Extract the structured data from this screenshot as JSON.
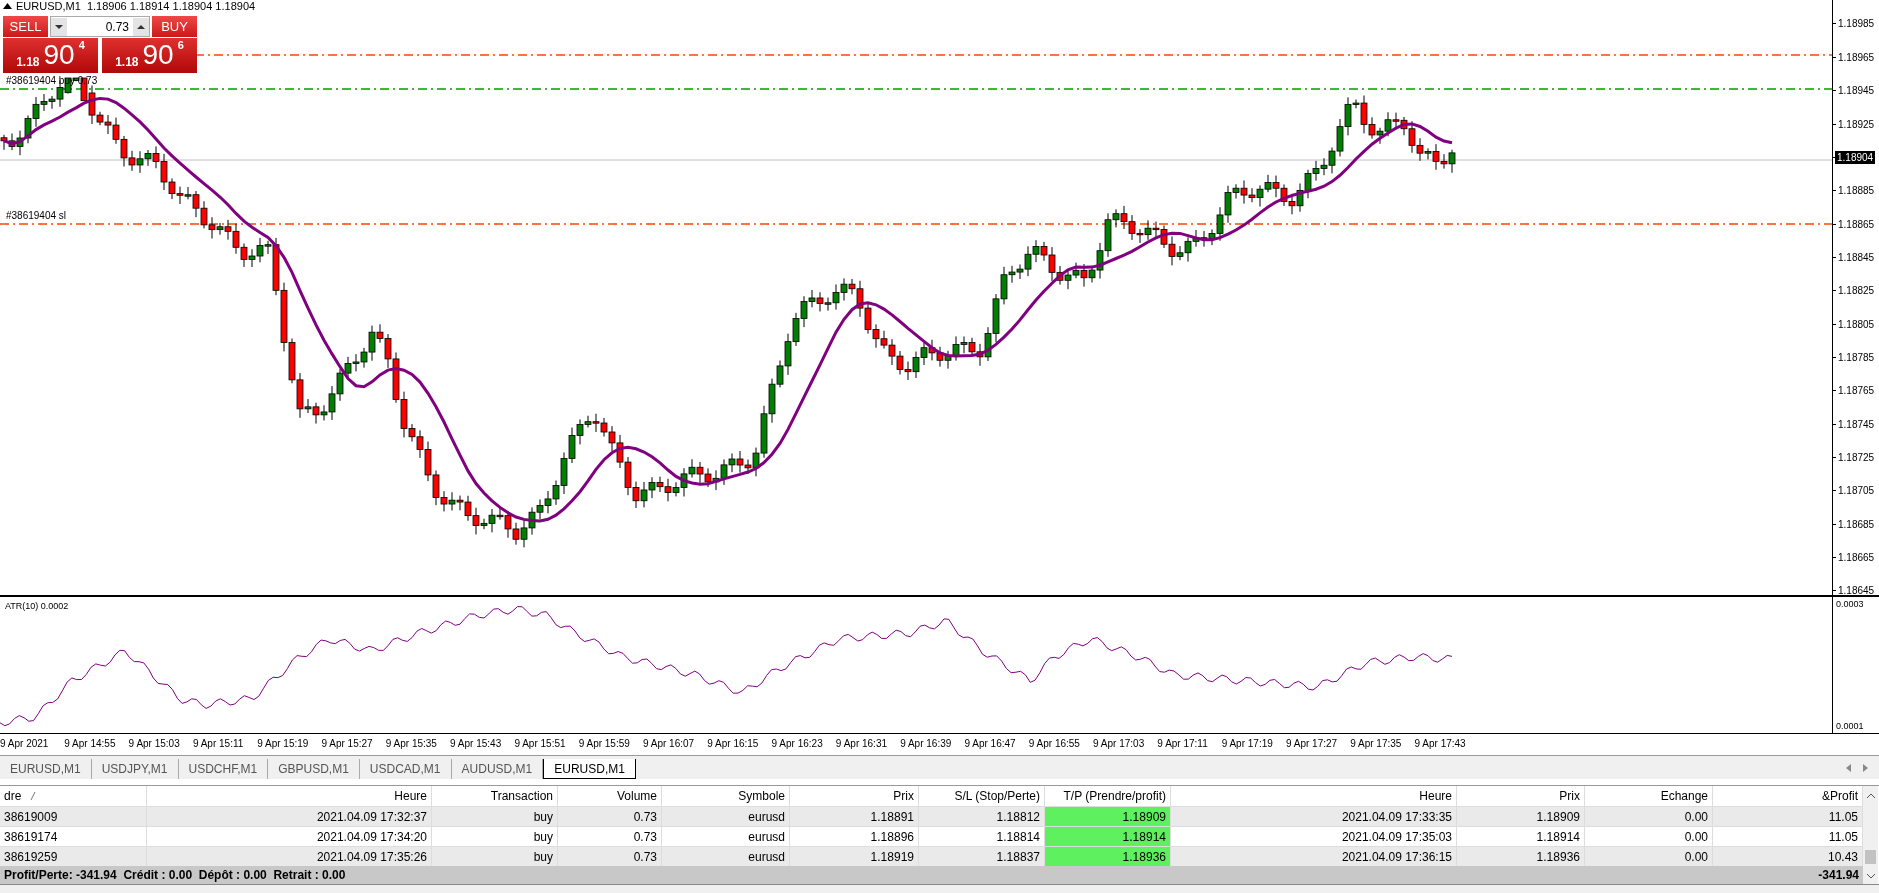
{
  "chart": {
    "symbol_info": "EURUSD,M1  1.18906 1.18914 1.18904 1.18904",
    "trade_panel": {
      "sell_label": "SELL",
      "buy_label": "BUY",
      "lot": "0.73",
      "sell_price": {
        "big_figure": "1.18",
        "pips": "90",
        "fraction": "4"
      },
      "buy_price": {
        "big_figure": "1.18",
        "pips": "90",
        "fraction": "6"
      }
    },
    "order_lines": [
      {
        "kind": "tp"
      },
      {
        "kind": "entry",
        "label": "#38619404 buy 0.73"
      },
      {
        "kind": "sl",
        "label": "#38619404 sl"
      }
    ],
    "price_axis": [
      "1.18985",
      "1.18965",
      "1.18945",
      "1.18925",
      "1.18885",
      "1.18865",
      "1.18845",
      "1.18825",
      "1.18805",
      "1.18785",
      "1.18765",
      "1.18745",
      "1.18725",
      "1.18705",
      "1.18685",
      "1.18665",
      "1.18645"
    ],
    "current_price": "1.18904",
    "indicator": {
      "label": "ATR(10) 0.0002",
      "axis": [
        "0.0003",
        "0.0001"
      ]
    },
    "time_axis": [
      "9 Apr 2021",
      "9 Apr 14:55",
      "9 Apr 15:03",
      "9 Apr 15:11",
      "9 Apr 15:19",
      "9 Apr 15:27",
      "9 Apr 15:35",
      "9 Apr 15:43",
      "9 Apr 15:51",
      "9 Apr 15:59",
      "9 Apr 16:07",
      "9 Apr 16:15",
      "9 Apr 16:23",
      "9 Apr 16:31",
      "9 Apr 16:39",
      "9 Apr 16:47",
      "9 Apr 16:55",
      "9 Apr 17:03",
      "9 Apr 17:11",
      "9 Apr 17:19",
      "9 Apr 17:27",
      "9 Apr 17:35",
      "9 Apr 17:43"
    ]
  },
  "tabs": [
    {
      "label": "EURUSD,M1",
      "selected": false
    },
    {
      "label": "USDJPY,M1",
      "selected": false
    },
    {
      "label": "USDCHF,M1",
      "selected": false
    },
    {
      "label": "GBPUSD,M1",
      "selected": false
    },
    {
      "label": "USDCAD,M1",
      "selected": false
    },
    {
      "label": "AUDUSD,M1",
      "selected": false
    },
    {
      "label": "EURUSD,M1",
      "selected": true
    }
  ],
  "table": {
    "columns": [
      "dre",
      "Heure",
      "Transaction",
      "Volume",
      "Symbole",
      "Prix",
      "S/L (Stop/Perte)",
      "T/P (Prendre/profit)",
      "Heure",
      "Prix",
      "Echange",
      "&Profit"
    ],
    "rows": [
      [
        "38619009",
        "2021.04.09 17:32:37",
        "buy",
        "0.73",
        "eurusd",
        "1.18891",
        "1.18812",
        "1.18909",
        "2021.04.09 17:33:35",
        "1.18909",
        "0.00",
        "11.05"
      ],
      [
        "38619174",
        "2021.04.09 17:34:20",
        "buy",
        "0.73",
        "eurusd",
        "1.18896",
        "1.18814",
        "1.18914",
        "2021.04.09 17:35:03",
        "1.18914",
        "0.00",
        "11.05"
      ],
      [
        "38619259",
        "2021.04.09 17:35:26",
        "buy",
        "0.73",
        "eurusd",
        "1.18919",
        "1.18837",
        "1.18936",
        "2021.04.09 17:36:15",
        "1.18936",
        "0.00",
        "10.43"
      ]
    ],
    "footer": {
      "summary": "Profit/Perte: -341.94  Crédit : 0.00  Dépôt : 0.00  Retrait : 0.00",
      "total": "-341.94"
    }
  }
}
